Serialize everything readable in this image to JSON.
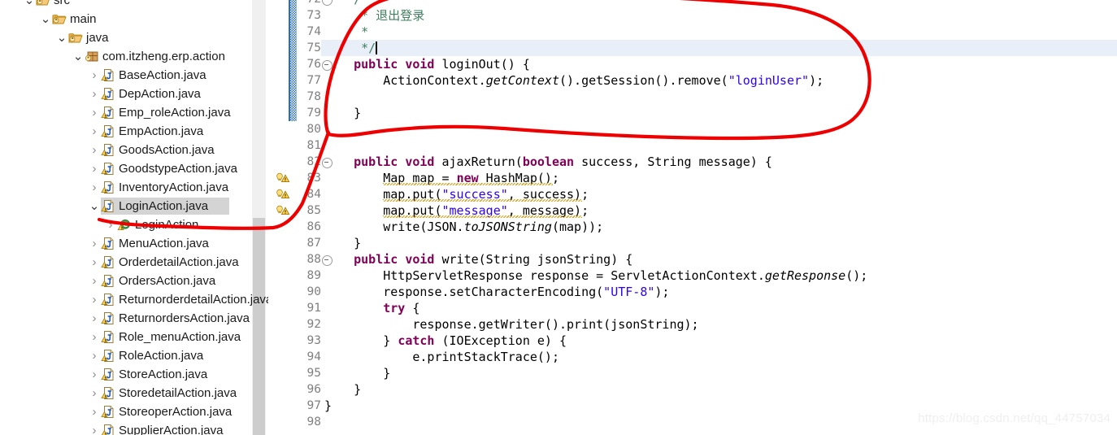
{
  "app": {
    "name": "Eclipse IDE",
    "watermark": "https://blog.csdn.net/qq_44757034"
  },
  "explorer": {
    "name": "Package Explorer",
    "scrollbar": {
      "name": "tree-vertical-scrollbar"
    },
    "items": [
      {
        "label": "src",
        "icon": "folder-icon",
        "indent": 0,
        "twisty": "expanded",
        "selected": false,
        "clipped": true
      },
      {
        "label": "main",
        "icon": "folder-icon",
        "indent": 1,
        "twisty": "expanded",
        "selected": false
      },
      {
        "label": "java",
        "icon": "folder-icon",
        "indent": 2,
        "twisty": "expanded",
        "selected": false
      },
      {
        "label": "com.itzheng.erp.action",
        "icon": "package-icon",
        "indent": 3,
        "twisty": "expanded",
        "selected": false
      },
      {
        "label": "BaseAction.java",
        "icon": "java-file-icon",
        "indent": 4,
        "twisty": "collapsed",
        "selected": false
      },
      {
        "label": "DepAction.java",
        "icon": "java-file-icon",
        "indent": 4,
        "twisty": "collapsed",
        "selected": false
      },
      {
        "label": "Emp_roleAction.java",
        "icon": "java-file-icon",
        "indent": 4,
        "twisty": "collapsed",
        "selected": false
      },
      {
        "label": "EmpAction.java",
        "icon": "java-file-icon",
        "indent": 4,
        "twisty": "collapsed",
        "selected": false
      },
      {
        "label": "GoodsAction.java",
        "icon": "java-file-icon",
        "indent": 4,
        "twisty": "collapsed",
        "selected": false
      },
      {
        "label": "GoodstypeAction.java",
        "icon": "java-file-icon",
        "indent": 4,
        "twisty": "collapsed",
        "selected": false
      },
      {
        "label": "InventoryAction.java",
        "icon": "java-file-icon",
        "indent": 4,
        "twisty": "collapsed",
        "selected": false
      },
      {
        "label": "LoginAction.java",
        "icon": "java-file-icon",
        "indent": 4,
        "twisty": "expanded",
        "selected": true
      },
      {
        "label": "LoginAction",
        "icon": "java-class-icon",
        "indent": 5,
        "twisty": "collapsed",
        "selected": false
      },
      {
        "label": "MenuAction.java",
        "icon": "java-file-icon",
        "indent": 4,
        "twisty": "collapsed",
        "selected": false
      },
      {
        "label": "OrderdetailAction.java",
        "icon": "java-file-icon",
        "indent": 4,
        "twisty": "collapsed",
        "selected": false
      },
      {
        "label": "OrdersAction.java",
        "icon": "java-file-icon",
        "indent": 4,
        "twisty": "collapsed",
        "selected": false
      },
      {
        "label": "ReturnorderdetailAction.java",
        "icon": "java-file-icon",
        "indent": 4,
        "twisty": "collapsed",
        "selected": false
      },
      {
        "label": "ReturnordersAction.java",
        "icon": "java-file-icon",
        "indent": 4,
        "twisty": "collapsed",
        "selected": false
      },
      {
        "label": "Role_menuAction.java",
        "icon": "java-file-icon",
        "indent": 4,
        "twisty": "collapsed",
        "selected": false
      },
      {
        "label": "RoleAction.java",
        "icon": "java-file-icon",
        "indent": 4,
        "twisty": "collapsed",
        "selected": false
      },
      {
        "label": "StoreAction.java",
        "icon": "java-file-icon",
        "indent": 4,
        "twisty": "collapsed",
        "selected": false
      },
      {
        "label": "StoredetailAction.java",
        "icon": "java-file-icon",
        "indent": 4,
        "twisty": "collapsed",
        "selected": false
      },
      {
        "label": "StoreoperAction.java",
        "icon": "java-file-icon",
        "indent": 4,
        "twisty": "collapsed",
        "selected": false
      },
      {
        "label": "SupplierAction.java",
        "icon": "java-file-icon",
        "indent": 4,
        "twisty": "collapsed",
        "selected": false
      }
    ]
  },
  "editor": {
    "name": "java-source-editor",
    "current_line": 75,
    "first_visible_line": 72,
    "last_visible_line": 98,
    "change_bar_lines": [
      72,
      73,
      74,
      75,
      76,
      77,
      78,
      79
    ],
    "warning_marker_lines": [
      83,
      84,
      85
    ],
    "folding_marker_lines": [
      72,
      76,
      82,
      88
    ],
    "colors": {
      "keyword": "#7f0055",
      "string": "#2a00ff",
      "comment": "#3f7f5f",
      "plain": "#000000",
      "line_number": "#808080",
      "current_line_bg": "#e8eff9",
      "change_bar": "#2a6ebb",
      "annotation": "#ee0000",
      "selection_bg": "#d4d4d4",
      "warning_squiggle": "#d4a017"
    },
    "lines": [
      {
        "n": 72,
        "text": "    /*"
      },
      {
        "n": 73,
        "text": "     * 退出登录"
      },
      {
        "n": 74,
        "text": "     *"
      },
      {
        "n": 75,
        "text": "     */"
      },
      {
        "n": 76,
        "text": "    public void loginOut() {"
      },
      {
        "n": 77,
        "text": "        ActionContext.getContext().getSession().remove(\"loginUser\");"
      },
      {
        "n": 78,
        "text": ""
      },
      {
        "n": 79,
        "text": "    }"
      },
      {
        "n": 80,
        "text": ""
      },
      {
        "n": 81,
        "text": ""
      },
      {
        "n": 82,
        "text": "    public void ajaxReturn(boolean success, String message) {"
      },
      {
        "n": 83,
        "text": "        Map map = new HashMap();"
      },
      {
        "n": 84,
        "text": "        map.put(\"success\", success);"
      },
      {
        "n": 85,
        "text": "        map.put(\"message\", message);"
      },
      {
        "n": 86,
        "text": "        write(JSON.toJSONString(map));"
      },
      {
        "n": 87,
        "text": "    }"
      },
      {
        "n": 88,
        "text": "    public void write(String jsonString) {"
      },
      {
        "n": 89,
        "text": "        HttpServletResponse response = ServletActionContext.getResponse();"
      },
      {
        "n": 90,
        "text": "        response.setCharacterEncoding(\"UTF-8\");"
      },
      {
        "n": 91,
        "text": "        try {"
      },
      {
        "n": 92,
        "text": "            response.getWriter().print(jsonString);"
      },
      {
        "n": 93,
        "text": "        } catch (IOException e) {"
      },
      {
        "n": 94,
        "text": "            e.printStackTrace();"
      },
      {
        "n": 95,
        "text": "        }"
      },
      {
        "n": 96,
        "text": "    }"
      },
      {
        "n": 97,
        "text": "}"
      },
      {
        "n": 98,
        "text": ""
      }
    ]
  },
  "annotation": {
    "name": "red-pen-markup",
    "color": "#ee0000",
    "shapes": [
      "ellipse-around-loginOut-method",
      "arrow-to-LoginAction-java"
    ]
  }
}
